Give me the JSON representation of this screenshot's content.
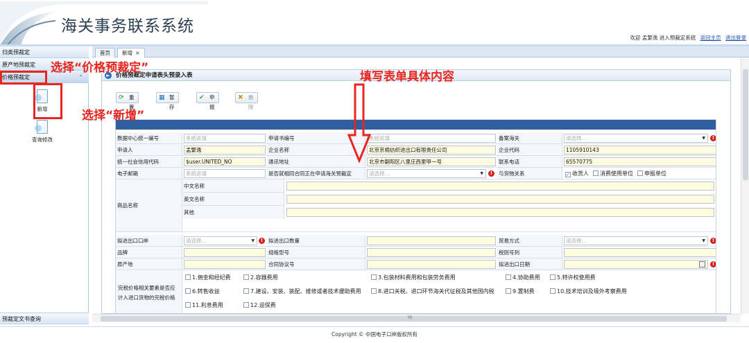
{
  "header": {
    "title": "海关事务联系系统",
    "welcome": "欢迎 孟繁逸 进入预裁定系统",
    "links": [
      "返回主页",
      "退出登录"
    ]
  },
  "sidebar": {
    "sections": [
      "归类预裁定",
      "原产地预裁定",
      "价格预裁定"
    ],
    "items": [
      "新增",
      "查询修改"
    ],
    "bottom": "预裁定文书查询"
  },
  "tabs": [
    "首页",
    "新增"
  ],
  "annotations": {
    "select_price": "选择“价格预裁定”",
    "select_new": "选择“新增”",
    "fill_form": "填写表单具体内容"
  },
  "panel": {
    "title": "价格预裁定申请表头预录入表",
    "buttons": [
      "重置",
      "暂存",
      "申报",
      "删除"
    ]
  },
  "form": {
    "r1": {
      "l1": "数据中心统一编号",
      "v1": "系统返填",
      "l2": "申请书编号",
      "v2": "系统返填",
      "l3": "备案海关",
      "v3": "请选择..."
    },
    "r2": {
      "l1": "申请人",
      "v1": "孟繁逸",
      "l2": "企业名称",
      "v2": "北京京棉纺织进出口有限责任公司",
      "l3": "企业代码",
      "v3": "1105910143"
    },
    "r3": {
      "l1": "统一社会信用代码",
      "v1": "$user.UNITED_NO",
      "l2": "通讯地址",
      "v2": "北京市朝阳区八里庄西里甲一号",
      "l3": "联系电话",
      "v3": "65570775"
    },
    "r4": {
      "l1": "电子邮箱",
      "v1": "系统返填",
      "l2": "是否就相同合同正在申请海关预裁定",
      "v2": "请选择...",
      "l3": "与货物关系",
      "checks": [
        {
          "label": "收货人",
          "checked": true
        },
        {
          "label": "消费使用单位",
          "checked": false
        },
        {
          "label": "申报单位",
          "checked": false
        }
      ]
    },
    "goods_name": {
      "label": "商品名称",
      "subs": [
        "中文名称",
        "英文名称",
        "其他"
      ]
    },
    "r5": {
      "l1": "拟进出口口岸",
      "v1": "请选择...",
      "l2": "拟进出口数量",
      "l3": "贸易方式",
      "v3": "请选择..."
    },
    "r6": {
      "l1": "品牌",
      "l2": "规格型号",
      "l3": "税则号列"
    },
    "r7": {
      "l1": "原产地",
      "l2": "合同协议号",
      "l3": "拟进出口日期"
    },
    "price_factors": {
      "label": "完税价格相关要素是否应计入进口货物的完税价格",
      "row1": [
        "1.佣金和经纪费",
        "2.容器费用",
        "3.包装材料费用和包装劳务费用",
        "4.协助费用",
        "5.特许权使用费"
      ],
      "row2": [
        "6.转售收益",
        "7.建设、安装、装配、维修或者技术援助费用",
        "8.进口关税、进口环节海关代征税及其他国内税",
        "9.置制费",
        "10.技术培训及境外考察费用"
      ],
      "row3": [
        "11.利息费用",
        "12.运保费"
      ]
    }
  },
  "hscroll_label": "III",
  "footer": "Copyright © 中国电子口岸版权所有",
  "colors": {
    "accent": "#2f5f9e",
    "annotation": "#e8261f",
    "required": "#d6211f",
    "filled": "#fffbe0"
  }
}
